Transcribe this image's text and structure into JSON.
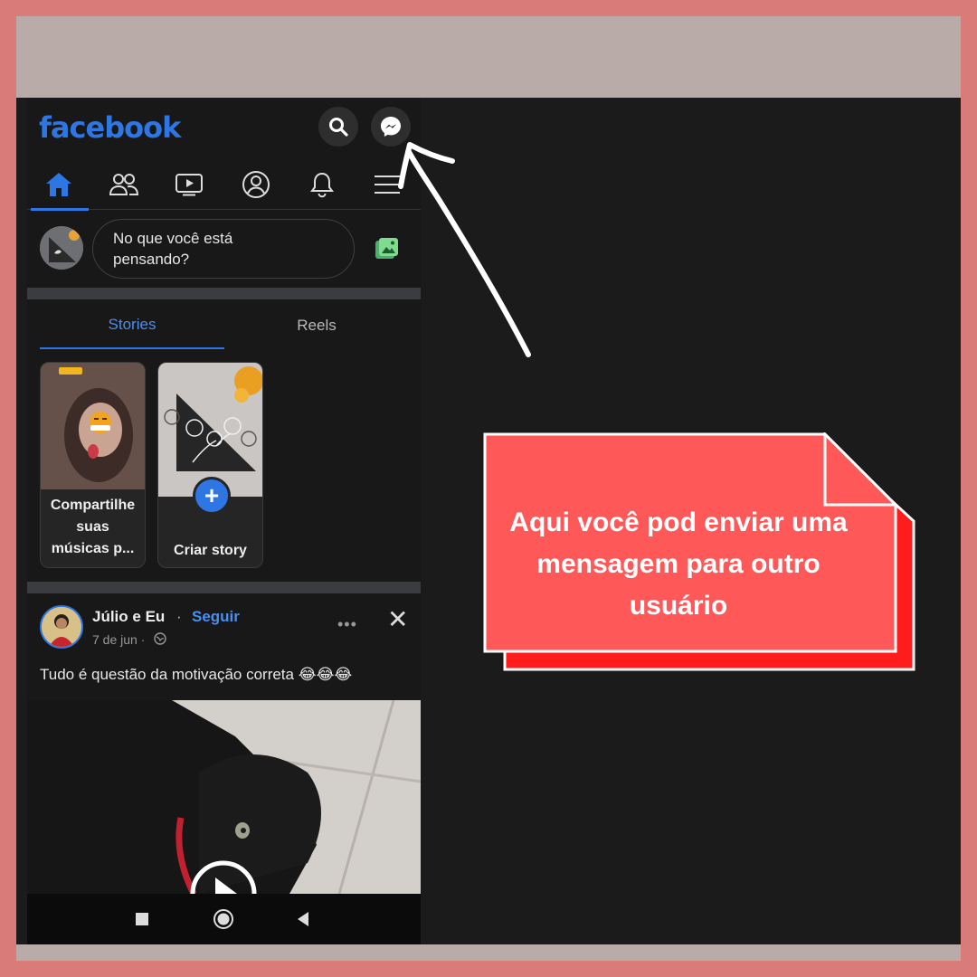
{
  "app": {
    "brand": "facebook",
    "accent_color": "#2d76e4"
  },
  "header": {
    "search_icon": "search-icon",
    "messenger_icon": "messenger-icon"
  },
  "nav": {
    "items": [
      "home-icon",
      "friends-icon",
      "watch-icon",
      "profile-icon",
      "bell-icon",
      "menu-icon"
    ],
    "active": "home"
  },
  "composer": {
    "prompt_line1": "No que você está",
    "prompt_line2": "pensando?"
  },
  "tabs": {
    "stories": "Stories",
    "reels": "Reels"
  },
  "stories": [
    {
      "line1": "Compartilhe",
      "line2": "suas",
      "line3": "músicas p..."
    },
    {
      "label": "Criar story"
    }
  ],
  "post": {
    "author": "Júlio e Eu",
    "separator": "·",
    "follow": "Seguir",
    "date": "7 de jun ·",
    "text": "Tudo é questão da motivação correta 😂😂😂"
  },
  "annotation": {
    "line1": "Aqui você pod enviar uma",
    "line2": "mensagem para outro",
    "line3": "usuário",
    "note_color": "#ff5858",
    "shadow_color": "#ff1c1c"
  }
}
